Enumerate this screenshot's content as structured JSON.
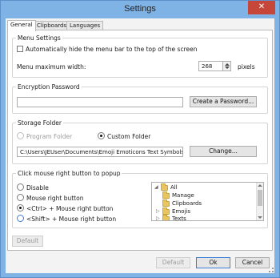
{
  "window": {
    "title": "Settings",
    "close_glyph": "✕"
  },
  "tabs": [
    {
      "label": "General",
      "active": true
    },
    {
      "label": "Clipboards",
      "active": false
    },
    {
      "label": "Languages",
      "active": false
    }
  ],
  "menu_settings": {
    "title": "Menu Settings",
    "auto_hide_label": "Automatically hide the menu bar to the top of the screen",
    "auto_hide_checked": false,
    "max_width_label": "Menu maximum width:",
    "max_width_value": "268",
    "max_width_unit": "pixels"
  },
  "encryption": {
    "title": "Encryption Password",
    "password_value": "",
    "create_button": "Create a Password..."
  },
  "storage": {
    "title": "Storage Folder",
    "program_folder_label": "Program Folder",
    "custom_folder_label": "Custom Folder",
    "selected": "custom",
    "path_value": "C:\\Users\\JEUser\\Documents\\Emoji Emoticons Text Symbols Paster",
    "change_button": "Change..."
  },
  "popup": {
    "title": "Click mouse right button to popup",
    "options": [
      {
        "label": "Disable",
        "selected": false
      },
      {
        "label": "Mouse right button",
        "selected": false
      },
      {
        "label": "<Ctrl> + Mouse right button",
        "selected": true
      },
      {
        "label": "<Shift> + Mouse right button",
        "selected": false
      }
    ],
    "tree": [
      {
        "label": "All",
        "level": 0,
        "expander": "◢"
      },
      {
        "label": "Manage",
        "level": 1,
        "expander": ""
      },
      {
        "label": "Clipboards",
        "level": 1,
        "expander": ""
      },
      {
        "label": "Emojis",
        "level": 1,
        "expander": "▷"
      },
      {
        "label": "Texts",
        "level": 1,
        "expander": "▷"
      }
    ]
  },
  "footer": {
    "panel_default_button": "Default",
    "default_button": "Default",
    "ok_button": "Ok",
    "cancel_button": "Cancel"
  },
  "colors": {
    "window_frame": "#7fb3e6",
    "close_button": "#c7463a",
    "focus_accent": "#3c7fd8",
    "folder": "#e8c560"
  },
  "icons": {
    "close": "close-icon",
    "folder": "folder-icon",
    "resize_grip": "resize-grip-icon"
  }
}
